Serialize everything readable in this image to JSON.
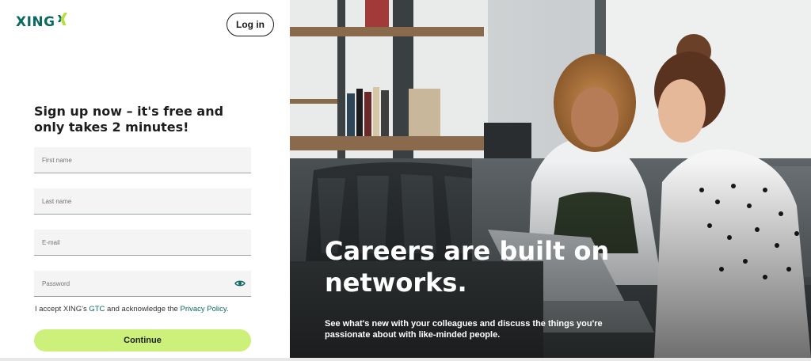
{
  "brand": {
    "name": "XING",
    "color": "#0a6960",
    "accent_lime": "#cdf07a"
  },
  "header": {
    "login_label": "Log in"
  },
  "form": {
    "title": "Sign up now – it's free and only takes 2 minutes!",
    "first_name_placeholder": "First name",
    "last_name_placeholder": "Last name",
    "email_placeholder": "E-mail",
    "password_placeholder": "Password",
    "password_toggle_icon": "eye-icon",
    "terms_prefix": "I accept XING's ",
    "terms_gtc": "GTC",
    "terms_middle": " and acknowledge the ",
    "terms_privacy": "Privacy Policy",
    "terms_suffix": ".",
    "continue_label": "Continue"
  },
  "hero": {
    "headline": "Careers are built on networks.",
    "subtext": "See what's new with your colleagues and discuss the things you're passionate about with like-minded people."
  }
}
